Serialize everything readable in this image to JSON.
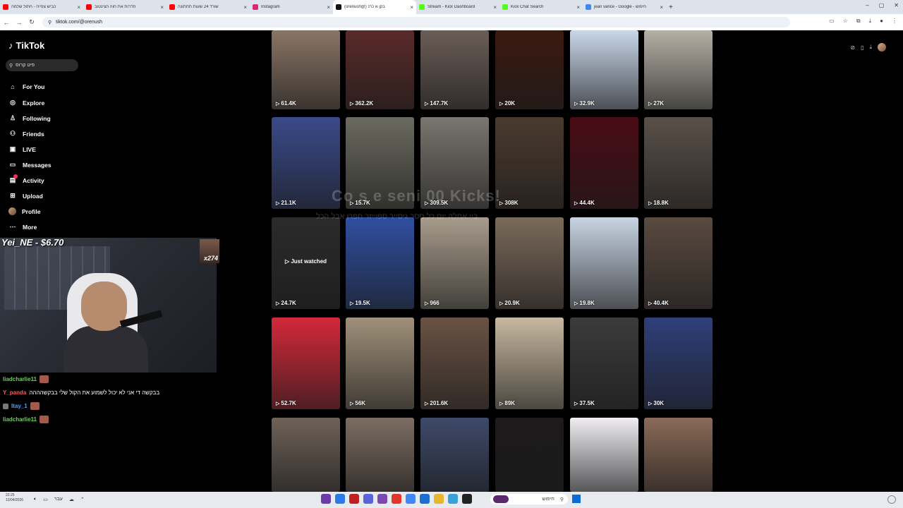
{
  "browser": {
    "tabs": [
      {
        "title": "כביש צפייה - חתול שלמה",
        "icon_color": "#ff0000",
        "active": false
      },
      {
        "title": "חדרות את חוה הצינטוב",
        "icon_color": "#ff0000",
        "active": false
      },
      {
        "title": "שורד 24 שעות תחתונה",
        "icon_color": "#ff0000",
        "active": false
      },
      {
        "title": "Instagram",
        "icon_color": "#d62976",
        "active": false
      },
      {
        "title": "(orenush@) בקן א כרנ",
        "icon_color": "#111111",
        "active": true
      },
      {
        "title": "Stream - Kick Dashboard",
        "icon_color": "#53fc18",
        "active": false
      },
      {
        "title": "Kick Chat Search",
        "icon_color": "#53fc18",
        "active": false
      },
      {
        "title": "jean vance - Google - חיפוש",
        "icon_color": "#4285f4",
        "active": false
      }
    ],
    "new_tab": "+",
    "url": "tiktok.com/@orenush"
  },
  "tiktok": {
    "logo": "TikTok",
    "search_placeholder": "פיט קרוס",
    "menu": [
      {
        "label": "For You",
        "icon": "home-icon",
        "glyph": "⌂"
      },
      {
        "label": "Explore",
        "icon": "compass-icon",
        "glyph": "◎"
      },
      {
        "label": "Following",
        "icon": "following-icon",
        "glyph": "♙"
      },
      {
        "label": "Friends",
        "icon": "friends-icon",
        "glyph": "⚇"
      },
      {
        "label": "LIVE",
        "icon": "live-icon",
        "glyph": "▣"
      },
      {
        "label": "Messages",
        "icon": "messages-icon",
        "glyph": "▭"
      },
      {
        "label": "Activity",
        "icon": "activity-icon",
        "glyph": "▤"
      },
      {
        "label": "Upload",
        "icon": "upload-icon",
        "glyph": "⊞"
      },
      {
        "label": "Profile",
        "icon": "avatar",
        "glyph": ""
      },
      {
        "label": "More",
        "icon": "more-icon",
        "glyph": "⋯"
      }
    ]
  },
  "overlay": {
    "donation": "Yei_NE - $6.70",
    "gift_count": "x274",
    "ghost_title": "Co    s  e  seni  00 Kicks!",
    "ghost_sub": "ביי אחלה יום כל ססר גיסייר  ספוייזר חפרן אבל הכל"
  },
  "chat": [
    {
      "user": "liadcharlie11",
      "color": "#6bd15c",
      "text": "",
      "emote": true
    },
    {
      "user": "Y_panda",
      "color": "#ff5a5a",
      "text": "בבקשה די אני לא יכול לשמוע את הקול שלי בבקשהההה",
      "emote": false
    },
    {
      "user": "Itay_1",
      "color": "#4fa3ff",
      "text": "",
      "emote": true
    },
    {
      "user": "liadcharlie11",
      "color": "#6bd15c",
      "text": "",
      "emote": true
    }
  ],
  "videos": [
    {
      "views": "61.4K",
      "bg": "#8a7566"
    },
    {
      "views": "362.2K",
      "bg": "#5a2a2a"
    },
    {
      "views": "147.7K",
      "bg": "#6a5d57"
    },
    {
      "views": "20K",
      "bg": "#3a1a10"
    },
    {
      "views": "32.9K",
      "bg": "#c9d7ea"
    },
    {
      "views": "27K",
      "bg": "#b6b0a6"
    },
    {
      "views": "21.1K",
      "bg": "#3a4a8a"
    },
    {
      "views": "15.7K",
      "bg": "#6b6a60"
    },
    {
      "views": "309.5K",
      "bg": "#7a7670"
    },
    {
      "views": "308K",
      "bg": "#4a3a2e"
    },
    {
      "views": "44.4K",
      "bg": "#4a0b14"
    },
    {
      "views": "18.8K",
      "bg": "#5a5048"
    },
    {
      "views": "24.7K",
      "bg": "#2b2b2b",
      "just": "Just watched"
    },
    {
      "views": "19.5K",
      "bg": "#2f4fa0"
    },
    {
      "views": "966",
      "bg": "#a89c8c"
    },
    {
      "views": "20.9K",
      "bg": "#7a6a5a"
    },
    {
      "views": "19.8K",
      "bg": "#c8d4e4"
    },
    {
      "views": "40.4K",
      "bg": "#5a4a40"
    },
    {
      "views": "52.7K",
      "bg": "#d4283a"
    },
    {
      "views": "56K",
      "bg": "#a0907a"
    },
    {
      "views": "201.6K",
      "bg": "#6a5244"
    },
    {
      "views": "89K",
      "bg": "#c7b8a0"
    },
    {
      "views": "37.5K",
      "bg": "#3b3b3b"
    },
    {
      "views": "30K",
      "bg": "#2f3f7a"
    },
    {
      "views": "",
      "bg": "#6f6258"
    },
    {
      "views": "",
      "bg": "#7c6d62"
    },
    {
      "views": "",
      "bg": "#3e4a6a"
    },
    {
      "views": "",
      "bg": "#1c1a1a"
    },
    {
      "views": "",
      "bg": "#f0eef2"
    },
    {
      "views": "",
      "bg": "#8a6a58"
    }
  ],
  "taskbar": {
    "time": "22:25",
    "date": "12/04/2026",
    "lang": "עבר",
    "search_placeholder": "חיפוש",
    "apps": [
      "#6a3ca8",
      "#2a7be4",
      "#c02020",
      "#5b63d9",
      "#7a4ab0",
      "#e0362c",
      "#4285f4",
      "#1b6fd1",
      "#e8b531",
      "#3aa0d8",
      "#222222"
    ]
  }
}
